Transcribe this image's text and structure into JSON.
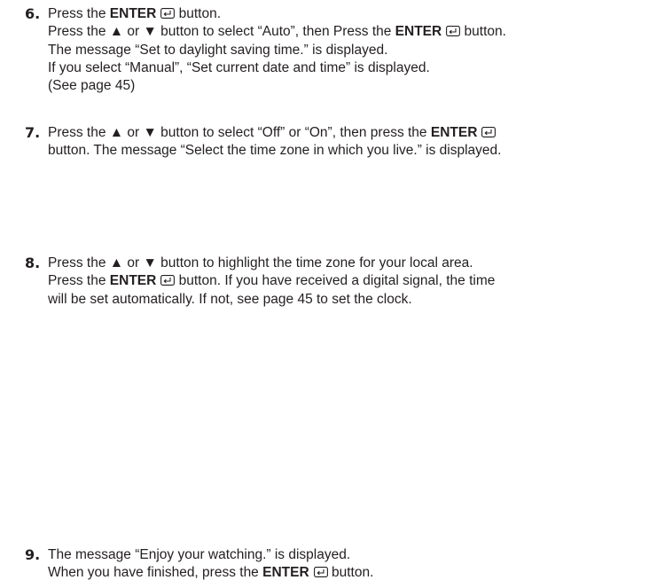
{
  "steps": [
    {
      "number": "6.",
      "lines": [
        [
          "Press the ",
          {
            "b": "ENTER"
          },
          {
            "icon": "enter"
          },
          " button."
        ],
        [
          "Press the ▲ or ▼ button to select “Auto”, then Press the ",
          {
            "b": "ENTER"
          },
          {
            "icon": "enter"
          },
          " button."
        ],
        [
          "The message “Set to daylight saving time.” is displayed."
        ],
        [
          "If you select “Manual”, “Set current date and time” is displayed."
        ],
        [
          "(See page 45)"
        ]
      ]
    },
    {
      "number": "7.",
      "lines": [
        [
          "Press the ▲ or ▼ button to select “Off” or “On”, then press the ",
          {
            "b": "ENTER"
          },
          {
            "icon": "enter"
          }
        ],
        [
          "button. The message “Select the time zone in which you live.” is displayed."
        ]
      ]
    },
    {
      "number": "8.",
      "lines": [
        [
          "Press the ▲ or ▼ button to highlight the time zone for your local area."
        ],
        [
          "Press the ",
          {
            "b": "ENTER"
          },
          {
            "icon": "enter"
          },
          " button. If you have received a digital signal, the time"
        ],
        [
          "will be set automatically. If not, see page 45 to set the clock."
        ]
      ]
    },
    {
      "number": "9.",
      "lines": [
        [
          "The message “Enjoy your watching.” is displayed."
        ],
        [
          "When you have finished, press the ",
          {
            "b": "ENTER"
          },
          {
            "icon": "enter"
          },
          " button."
        ]
      ]
    }
  ]
}
